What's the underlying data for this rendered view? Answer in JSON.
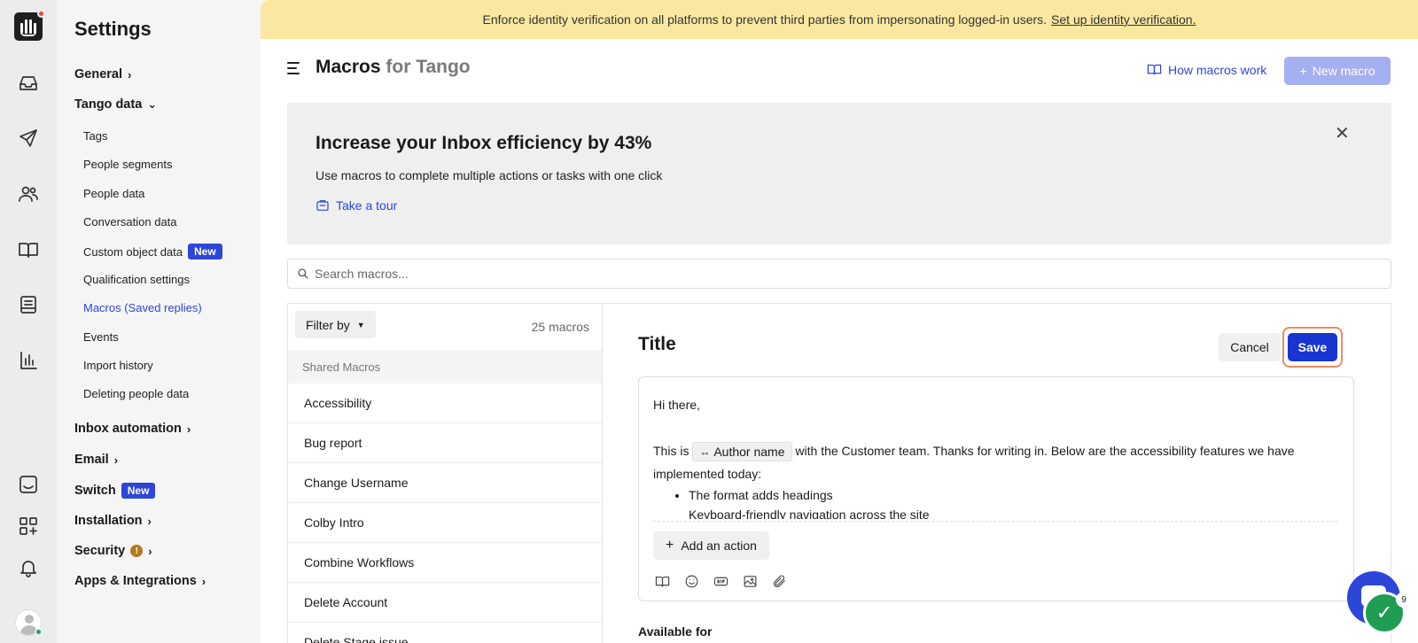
{
  "banner": {
    "message": "Enforce identity verification on all platforms to prevent third parties from impersonating logged-in users.",
    "link": "Set up identity verification."
  },
  "sidebar": {
    "title": "Settings",
    "groups": {
      "general": "General",
      "tango_data": "Tango data",
      "inbox_automation": "Inbox automation",
      "email": "Email",
      "switch": "Switch",
      "installation": "Installation",
      "security": "Security",
      "apps": "Apps & Integrations"
    },
    "items": [
      {
        "label": "Tags"
      },
      {
        "label": "People segments"
      },
      {
        "label": "People data"
      },
      {
        "label": "Conversation data"
      },
      {
        "label": "Custom object data"
      },
      {
        "label": "Qualification settings"
      },
      {
        "label": "Macros (Saved replies)"
      },
      {
        "label": "Events"
      },
      {
        "label": "Import history"
      },
      {
        "label": "Deleting people data"
      }
    ],
    "new_badge": "New",
    "security_warning": "!"
  },
  "header": {
    "title": "Macros",
    "title_suffix": "for Tango",
    "how_link": "How macros work",
    "new_macro": "New macro"
  },
  "promo": {
    "title": "Increase your Inbox efficiency by 43%",
    "description": "Use macros to complete multiple actions or tasks with one click",
    "tour": "Take a tour",
    "close": "✕"
  },
  "search": {
    "placeholder": "Search macros..."
  },
  "list": {
    "filter_label": "Filter by",
    "count": "25 macros",
    "section": "Shared Macros",
    "macros": [
      {
        "name": "Accessibility"
      },
      {
        "name": "Bug report"
      },
      {
        "name": "Change Username"
      },
      {
        "name": "Colby Intro"
      },
      {
        "name": "Combine Workflows"
      },
      {
        "name": "Delete Account"
      },
      {
        "name": "Delete Stage issue"
      }
    ]
  },
  "editor": {
    "title": "Title",
    "cancel": "Cancel",
    "save": "Save",
    "greeting": "Hi there,",
    "body_prefix": "This is",
    "chip": "Author name",
    "body_suffix": "with the Customer team. Thanks for writing in. Below are the accessibility features we have implemented today:",
    "bullets": [
      "The format adds headings",
      "Keyboard-friendly navigation across the site"
    ],
    "add_action": "Add an action",
    "available_for": "Available for"
  },
  "widgets": {
    "check_badge": "9"
  },
  "colors": {
    "accent": "#2e46d8",
    "save": "#1935d1",
    "banner": "#fbe8a0"
  }
}
